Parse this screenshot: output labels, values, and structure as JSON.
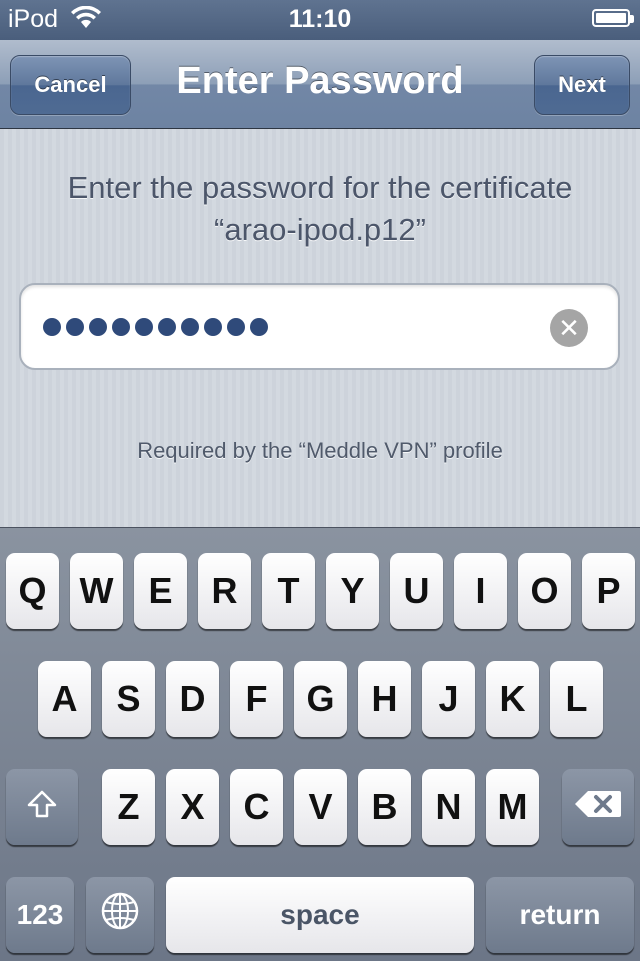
{
  "status_bar": {
    "carrier": "iPod",
    "time": "11:10",
    "wifi_icon": "wifi-icon",
    "battery_icon": "battery-icon"
  },
  "nav": {
    "cancel_label": "Cancel",
    "title": "Enter Password",
    "next_label": "Next"
  },
  "content": {
    "prompt_line1": "Enter the password for the certificate",
    "prompt_line2": "“arao-ipod.p12”",
    "password_dot_count": 10,
    "clear_icon": "clear-icon",
    "footnote": "Required by the “Meddle VPN” profile"
  },
  "keyboard": {
    "row1": [
      "Q",
      "W",
      "E",
      "R",
      "T",
      "Y",
      "U",
      "I",
      "O",
      "P"
    ],
    "row2": [
      "A",
      "S",
      "D",
      "F",
      "G",
      "H",
      "J",
      "K",
      "L"
    ],
    "row3": [
      "Z",
      "X",
      "C",
      "V",
      "B",
      "N",
      "M"
    ],
    "shift_icon": "shift-icon",
    "delete_icon": "delete-icon",
    "numbers_label": "123",
    "globe_icon": "globe-icon",
    "space_label": "space",
    "return_label": "return"
  },
  "colors": {
    "accent": "#4a6690",
    "password_dots": "#2f4a7a"
  }
}
